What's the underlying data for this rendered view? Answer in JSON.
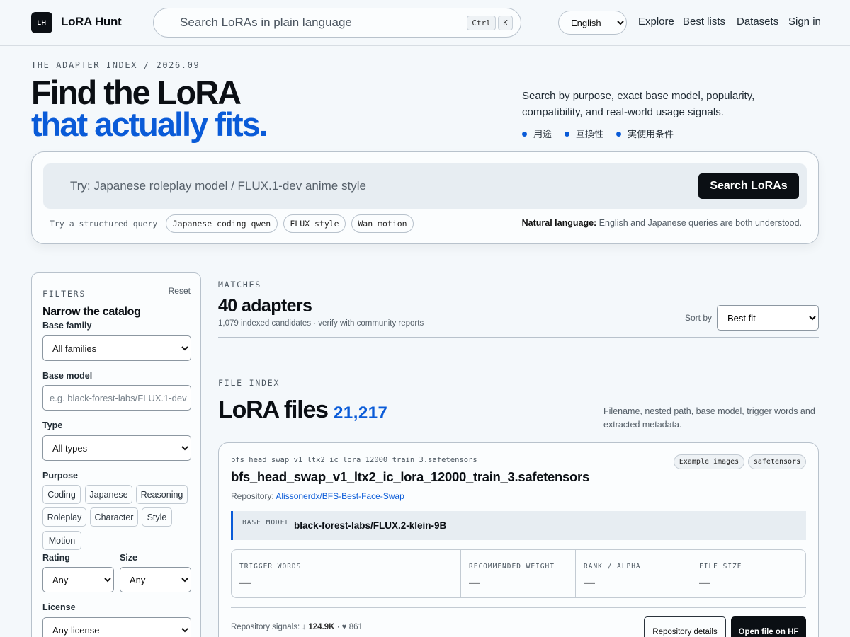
{
  "header": {
    "logo_text": "LH",
    "brand": "LoRA Hunt",
    "search_placeholder": "Search LoRAs in plain language",
    "kbd_ctrl": "Ctrl",
    "kbd_k": "K",
    "language": "English",
    "nav": [
      "Explore",
      "Best lists",
      "Datasets",
      "Sign in"
    ]
  },
  "hero": {
    "eyebrow": "THE ADAPTER INDEX / 2026.09",
    "title_line1": "Find the LoRA",
    "title_line2": "that actually fits.",
    "description": "Search by purpose, exact base model, popularity, compatibility, and real-world usage signals.",
    "tags": [
      "用途",
      "互換性",
      "実使用条件"
    ]
  },
  "search": {
    "placeholder": "Try: Japanese roleplay model / FLUX.1-dev anime style",
    "button": "Search LoRAs",
    "try_label": "Try a structured query",
    "chips": [
      "Japanese coding qwen",
      "FLUX style",
      "Wan motion"
    ],
    "note_bold": "Natural language:",
    "note_text": " English and Japanese queries are both understood."
  },
  "filters": {
    "eyebrow": "FILTERS",
    "reset": "Reset",
    "title": "Narrow the catalog",
    "base_family_label": "Base family",
    "base_family_value": "All families",
    "base_model_label": "Base model",
    "base_model_placeholder": "e.g. black-forest-labs/FLUX.1-dev",
    "type_label": "Type",
    "type_value": "All types",
    "purpose_label": "Purpose",
    "purposes": [
      "Coding",
      "Japanese",
      "Reasoning",
      "Roleplay",
      "Character",
      "Style",
      "Motion"
    ],
    "rating_label": "Rating",
    "rating_value": "Any",
    "size_label": "Size",
    "size_value": "Any",
    "license_label": "License",
    "license_value": "Any license"
  },
  "matches": {
    "eyebrow": "MATCHES",
    "count": "40 adapters",
    "sub": "1,079 indexed candidates · verify with community reports",
    "sort_label": "Sort by",
    "sort_value": "Best fit"
  },
  "file_index": {
    "eyebrow": "FILE INDEX",
    "title": "LoRA files",
    "count": "21,217",
    "description": "Filename, nested path, base model, trigger words and extracted metadata."
  },
  "file_card": {
    "path": "bfs_head_swap_v1_ltx2_ic_lora_12000_train_3.safetensors",
    "badges": [
      "Example images",
      "safetensors"
    ],
    "name": "bfs_head_swap_v1_ltx2_ic_lora_12000_train_3.safetensors",
    "repo_label": "Repository:",
    "repo": "Alissonerdx/BFS-Best-Face-Swap",
    "base_model_label": "BASE MODEL",
    "base_model": "black-forest-labs/FLUX.2-klein-9B",
    "stats": [
      {
        "label": "TRIGGER WORDS",
        "value": "—"
      },
      {
        "label": "RECOMMENDED WEIGHT",
        "value": "—"
      },
      {
        "label": "RANK / ALPHA",
        "value": "—"
      },
      {
        "label": "FILE SIZE",
        "value": "—"
      }
    ],
    "signals_label": "Repository signals:",
    "downloads": "124.9K",
    "likes": "861",
    "details_button": "Repository details",
    "open_button": "Open file on HF"
  },
  "colors": {
    "accent": "#0a5bd8",
    "ink": "#0b0f14",
    "background": "#f4f8fb"
  }
}
